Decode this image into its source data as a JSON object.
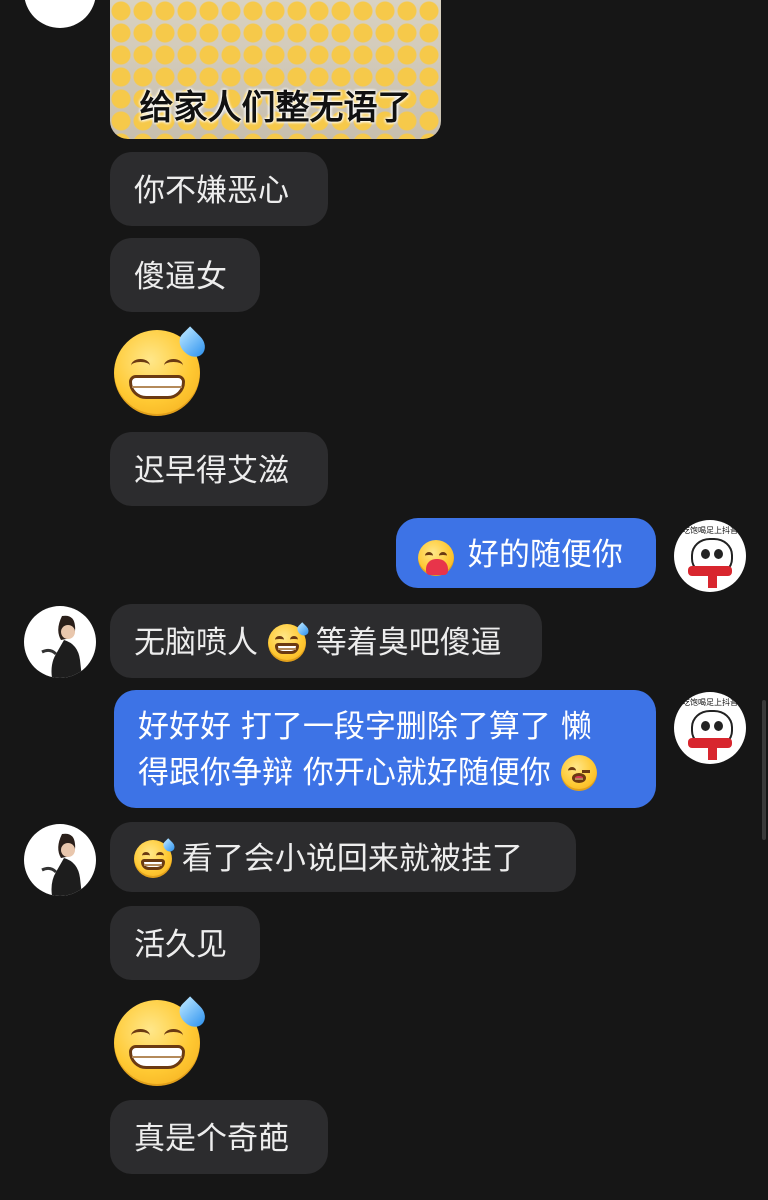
{
  "chat": {
    "meme_caption": "给家人们整无语了",
    "messages": [
      {
        "side": "in",
        "text": "你不嫌恶心"
      },
      {
        "side": "in",
        "text": "傻逼女"
      },
      {
        "side": "in",
        "emoji": "grin-sweat-icon"
      },
      {
        "side": "in",
        "text": "迟早得艾滋"
      },
      {
        "side": "out",
        "text": "好的随便你",
        "emoji": "hugging-face-icon"
      },
      {
        "side": "in",
        "text_a": "无脑喷人",
        "emoji": "grin-sweat-icon",
        "text_b": "等着臭吧傻逼"
      },
      {
        "side": "out",
        "line1": "好好好 打了一段字删除了算了 懒",
        "line2": "得跟你争辩 你开心就好随便你",
        "emoji": "winking-tongue-icon"
      },
      {
        "side": "in",
        "emoji": "grin-sweat-icon",
        "text": "看了会小说回来就被挂了"
      },
      {
        "side": "in",
        "text": "活久见"
      },
      {
        "side": "in",
        "emoji": "grin-sweat-icon"
      },
      {
        "side": "in",
        "text": "真是个奇葩"
      }
    ],
    "self_avatar_text": "吃饱喝足上抖音"
  },
  "colors": {
    "background": "#161616",
    "incoming_bubble": "#2c2c2e",
    "outgoing_bubble": "#3d73e6"
  }
}
